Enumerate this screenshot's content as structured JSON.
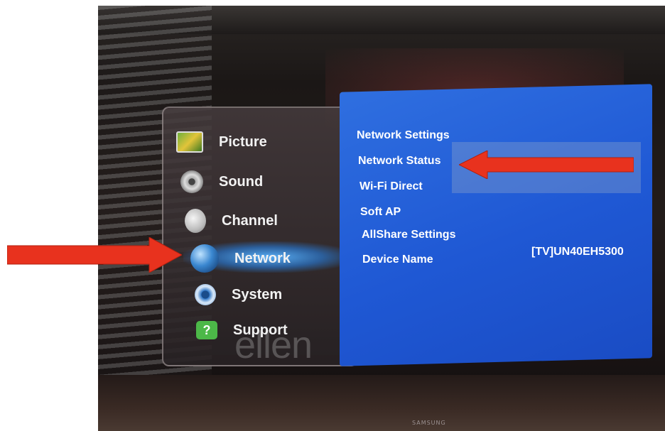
{
  "menu": {
    "items": [
      {
        "label": "Picture",
        "icon": "picture-icon"
      },
      {
        "label": "Sound",
        "icon": "sound-icon"
      },
      {
        "label": "Channel",
        "icon": "channel-icon"
      },
      {
        "label": "Network",
        "icon": "network-icon",
        "selected": true
      },
      {
        "label": "System",
        "icon": "system-icon"
      },
      {
        "label": "Support",
        "icon": "support-icon"
      }
    ]
  },
  "submenu": {
    "items": [
      {
        "label": "Network Settings"
      },
      {
        "label": "Network Status"
      },
      {
        "label": "Wi-Fi Direct"
      },
      {
        "label": "Soft AP"
      },
      {
        "label": "AllShare Settings"
      },
      {
        "label": "Device Name",
        "value": "[TV]UN40EH5300"
      }
    ]
  },
  "watermark": "ellen",
  "brand": "SAMSUNG",
  "colors": {
    "submenu_bg": "#1f58d4",
    "arrow": "#e8321e",
    "glow": "#4aa8ff"
  }
}
